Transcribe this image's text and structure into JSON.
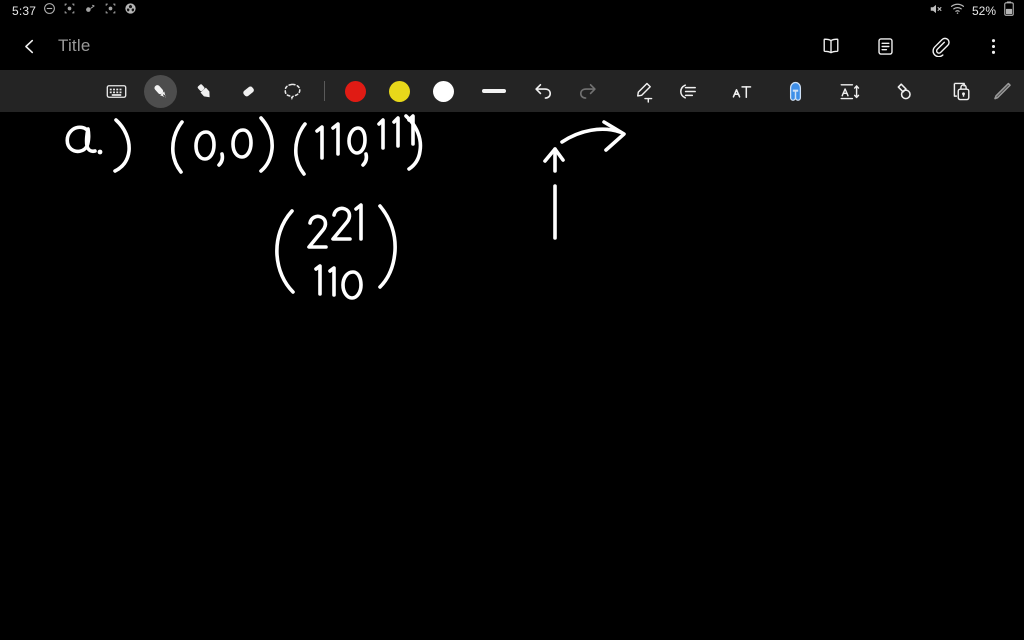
{
  "statusbar": {
    "time": "5:37",
    "left_icons": [
      "do-not-disturb-icon",
      "app-badge-icon-1",
      "app-badge-icon-2",
      "app-badge-icon-3",
      "app-badge-icon-4"
    ],
    "battery_percent": "52%",
    "right_icons": [
      "volume-muted-icon",
      "wifi-icon",
      "battery-icon"
    ]
  },
  "titlebar": {
    "back_label": "back-chevron-icon",
    "title": "Title",
    "actions": [
      {
        "name": "reading-mode-icon",
        "label": "Reading mode"
      },
      {
        "name": "note-list-icon",
        "label": "Notes"
      },
      {
        "name": "attachment-icon",
        "label": "Attach"
      },
      {
        "name": "overflow-menu-icon",
        "label": "More options"
      }
    ]
  },
  "toolbar": {
    "tools": [
      {
        "name": "keyboard-icon",
        "label": "Keyboard",
        "selected": false
      },
      {
        "name": "pen-icon",
        "label": "Pen",
        "selected": true
      },
      {
        "name": "highlighter-icon",
        "label": "Highlighter",
        "selected": false
      },
      {
        "name": "eraser-icon",
        "label": "Eraser",
        "selected": false
      },
      {
        "name": "lasso-select-icon",
        "label": "Lasso select",
        "selected": false
      }
    ],
    "colors": [
      {
        "name": "color-swatch-red",
        "label": "Red",
        "hex": "#e01b14",
        "selected": false
      },
      {
        "name": "color-swatch-yellow",
        "label": "Yellow",
        "hex": "#e8d81a",
        "selected": false
      },
      {
        "name": "color-swatch-white",
        "label": "White",
        "hex": "#ffffff",
        "selected": true
      }
    ],
    "stroke_weight": {
      "name": "stroke-thickness-icon",
      "label": "Thickness"
    },
    "actions": [
      {
        "name": "undo-icon",
        "label": "Undo",
        "enabled": true
      },
      {
        "name": "redo-icon",
        "label": "Redo",
        "enabled": false
      },
      {
        "name": "pen-to-text-icon",
        "label": "Convert handwriting to text",
        "enabled": true
      },
      {
        "name": "align-strokes-icon",
        "label": "Straighten strokes",
        "enabled": true
      },
      {
        "name": "text-recognition-icon",
        "label": "Text recognition",
        "enabled": true
      },
      {
        "name": "assistant-icon",
        "label": "Assistant",
        "enabled": true,
        "accent": "#3f8fe8"
      },
      {
        "name": "text-spacing-icon",
        "label": "Text spacing",
        "enabled": true
      },
      {
        "name": "shape-merge-icon",
        "label": "Shape tools",
        "enabled": true
      },
      {
        "name": "lock-page-icon",
        "label": "Lock page",
        "enabled": true
      }
    ],
    "collapse": {
      "name": "collapse-toolbar-pen-icon",
      "label": "Collapse toolbar"
    }
  },
  "canvas": {
    "ink_color": "#ffffff",
    "background": "#000000",
    "notes": [
      {
        "name": "ink-label-a",
        "text": "a.)"
      },
      {
        "name": "ink-coordinate-origin",
        "text": "(0,0)"
      },
      {
        "name": "ink-coordinate-pair",
        "text": "(110,111)"
      },
      {
        "name": "ink-matrix",
        "rows": [
          "2 2 1",
          "1 1 0"
        ]
      },
      {
        "name": "ink-arrow-up",
        "text": "up arrow"
      },
      {
        "name": "ink-arrow-right",
        "text": "curved right arrow"
      }
    ]
  }
}
